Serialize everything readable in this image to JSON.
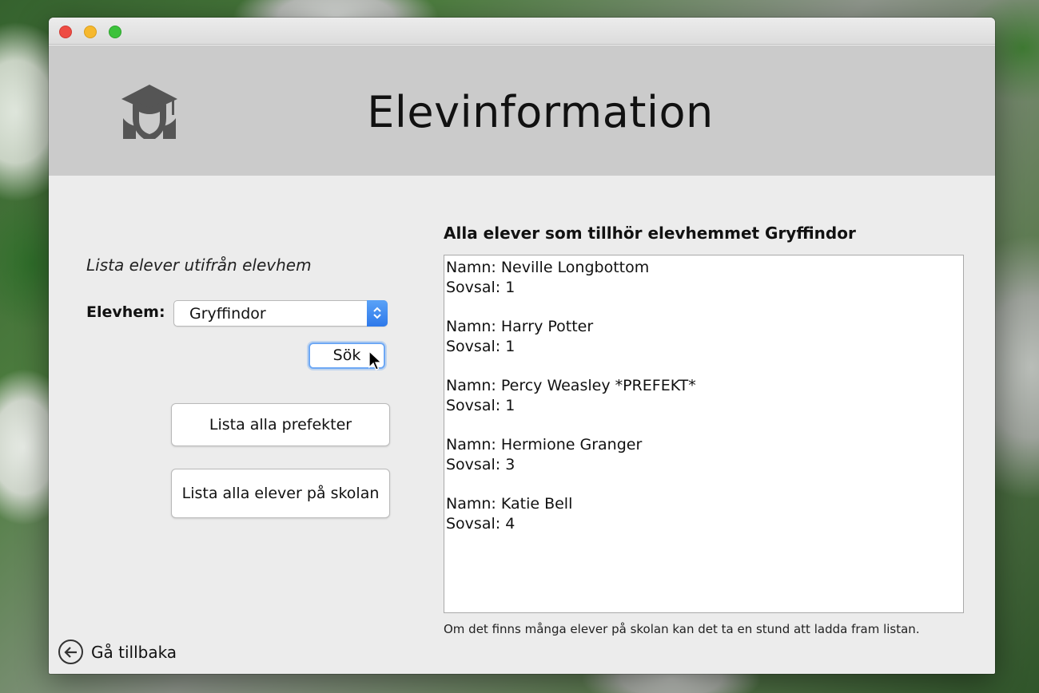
{
  "window": {
    "title": "Elevinformation"
  },
  "filter": {
    "section_label": "Lista elever utifrån elevhem",
    "house_label": "Elevhem:",
    "house_selected": "Gryffindor",
    "search_button": "Sök"
  },
  "actions": {
    "list_prefects": "Lista alla prefekter",
    "list_all_students": "Lista alla elever på skolan",
    "back": "Gå tillbaka"
  },
  "results": {
    "title": "Alla elever som tillhör elevhemmet Gryffindor",
    "entries": [
      {
        "name_line": "Namn: Neville Longbottom",
        "dorm_line": "Sovsal: 1"
      },
      {
        "name_line": "Namn: Harry Potter",
        "dorm_line": "Sovsal: 1"
      },
      {
        "name_line": "Namn: Percy Weasley *PREFEKT*",
        "dorm_line": "Sovsal: 1"
      },
      {
        "name_line": "Namn: Hermione Granger",
        "dorm_line": "Sovsal: 3"
      },
      {
        "name_line": "Namn: Katie Bell",
        "dorm_line": "Sovsal: 4"
      }
    ],
    "footnote": "Om det finns många elever på skolan kan det ta en stund att ladda fram listan."
  },
  "icons": {
    "logo": "student-graduation-cap-icon",
    "select_stepper": "chevron-up-down-icon",
    "back": "arrow-left-circle-icon",
    "cursor": "mouse-pointer-icon"
  },
  "colors": {
    "header_band": "#cbcbcb",
    "window_bg": "#ececec",
    "accent_blue": "#2e79ea",
    "focus_ring": "#6ea8f4"
  }
}
